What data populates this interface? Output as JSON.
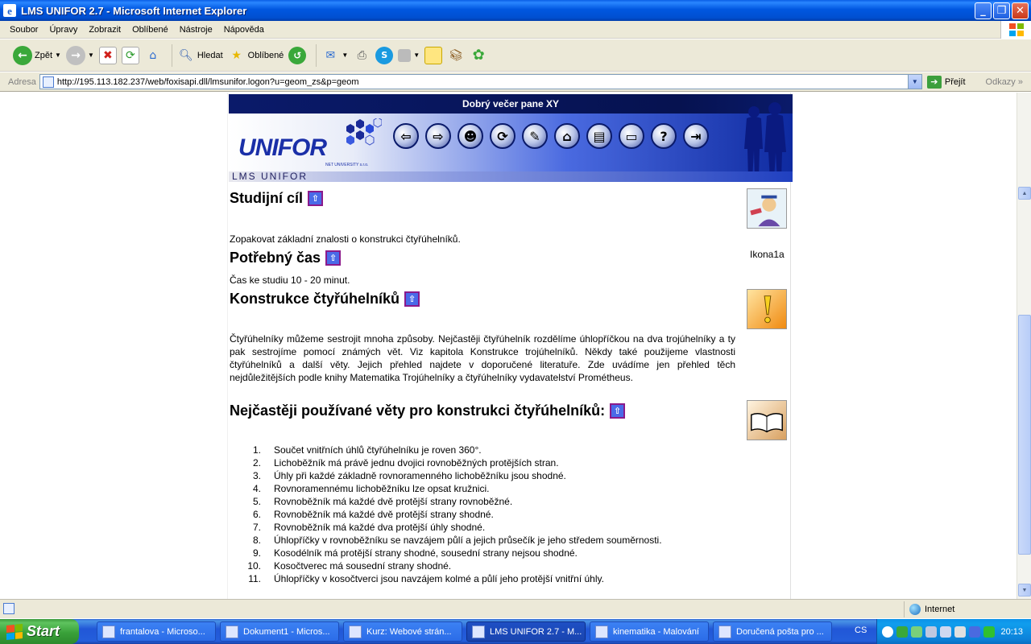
{
  "window": {
    "title": "LMS UNIFOR 2.7 - Microsoft Internet Explorer"
  },
  "menu": [
    "Soubor",
    "Úpravy",
    "Zobrazit",
    "Oblíbené",
    "Nástroje",
    "Nápověda"
  ],
  "toolbar": {
    "back": "Zpět",
    "search": "Hledat",
    "favorites": "Oblíbené"
  },
  "address": {
    "label": "Adresa",
    "url": "http://195.113.182.237/web/foxisapi.dll/lmsunifor.logon?u=geom_zs&p=geom",
    "go": "Přejít",
    "links": "Odkazy"
  },
  "banner": {
    "greeting": "Dobrý večer pane XY",
    "logo": "UNIFOR",
    "logo_sub": "NET UNIVERSITY s.r.o.",
    "lms": "LMS UNIFOR"
  },
  "content": {
    "goal_heading": "Studijní cíl",
    "goal_text": "Zopakovat základní znalosti o konstrukci čtyřúhelníků.",
    "icon_caption": "Ikona1a",
    "time_heading": "Potřebný čas",
    "time_text": "Čas ke studiu 10 - 20 minut.",
    "construction_heading": "Konstrukce čtyřúhelníků",
    "construction_text": "Čtyřúhelníky můžeme sestrojit mnoha způsoby. Nejčastěji čtyřúhelník rozdělíme úhlopříčkou na dva trojúhelníky a ty pak sestrojíme pomocí známých vět. Viz kapitola Konstrukce trojúhelníků. Někdy také použijeme vlastnosti čtyřúhelníků a další věty. Jejich přehled najdete v doporučené literatuře. Zde uvádíme jen přehled těch nejdůležitějších podle knihy Matematika Trojúhelníky a čtyřúhelníky vydavatelství Prométheus.",
    "rules_heading": "Nejčastěji používané věty pro konstrukci čtyřúhelníků:",
    "rules": [
      "Součet vnitřních úhlů čtyřúhelníku je roven 360°.",
      "Lichoběžník má právě jednu dvojici rovnoběžných protějších stran.",
      "Úhly při každé základně rovnoramenného lichoběžníku jsou shodné.",
      "Rovnoramennému lichoběžníku lze opsat kružnici.",
      "Rovnoběžník má každé dvě protější strany rovnoběžné.",
      "Rovnoběžník má každé dvě protější strany shodné.",
      "Rovnoběžník má každé dva protější úhly shodné.",
      "Úhlopříčky v rovnoběžníku se navzájem půlí a jejich průsečík je jeho středem souměrnosti.",
      "Kosodélník má protější strany shodné, sousední strany nejsou shodné.",
      "Kosočtverec má sousední strany shodné.",
      "Úhlopříčky v kosočtverci jsou navzájem kolmé a půlí jeho protější vnitřní úhly."
    ]
  },
  "status": {
    "zone": "Internet"
  },
  "taskbar": {
    "start": "Start",
    "tasks": [
      "frantalova - Microso...",
      "Dokument1 - Micros...",
      "Kurz: Webové strán...",
      "LMS UNIFOR 2.7 - M...",
      "kinematika - Malování",
      "Doručená pošta pro ..."
    ],
    "lang": "CS",
    "clock": "20:13"
  }
}
